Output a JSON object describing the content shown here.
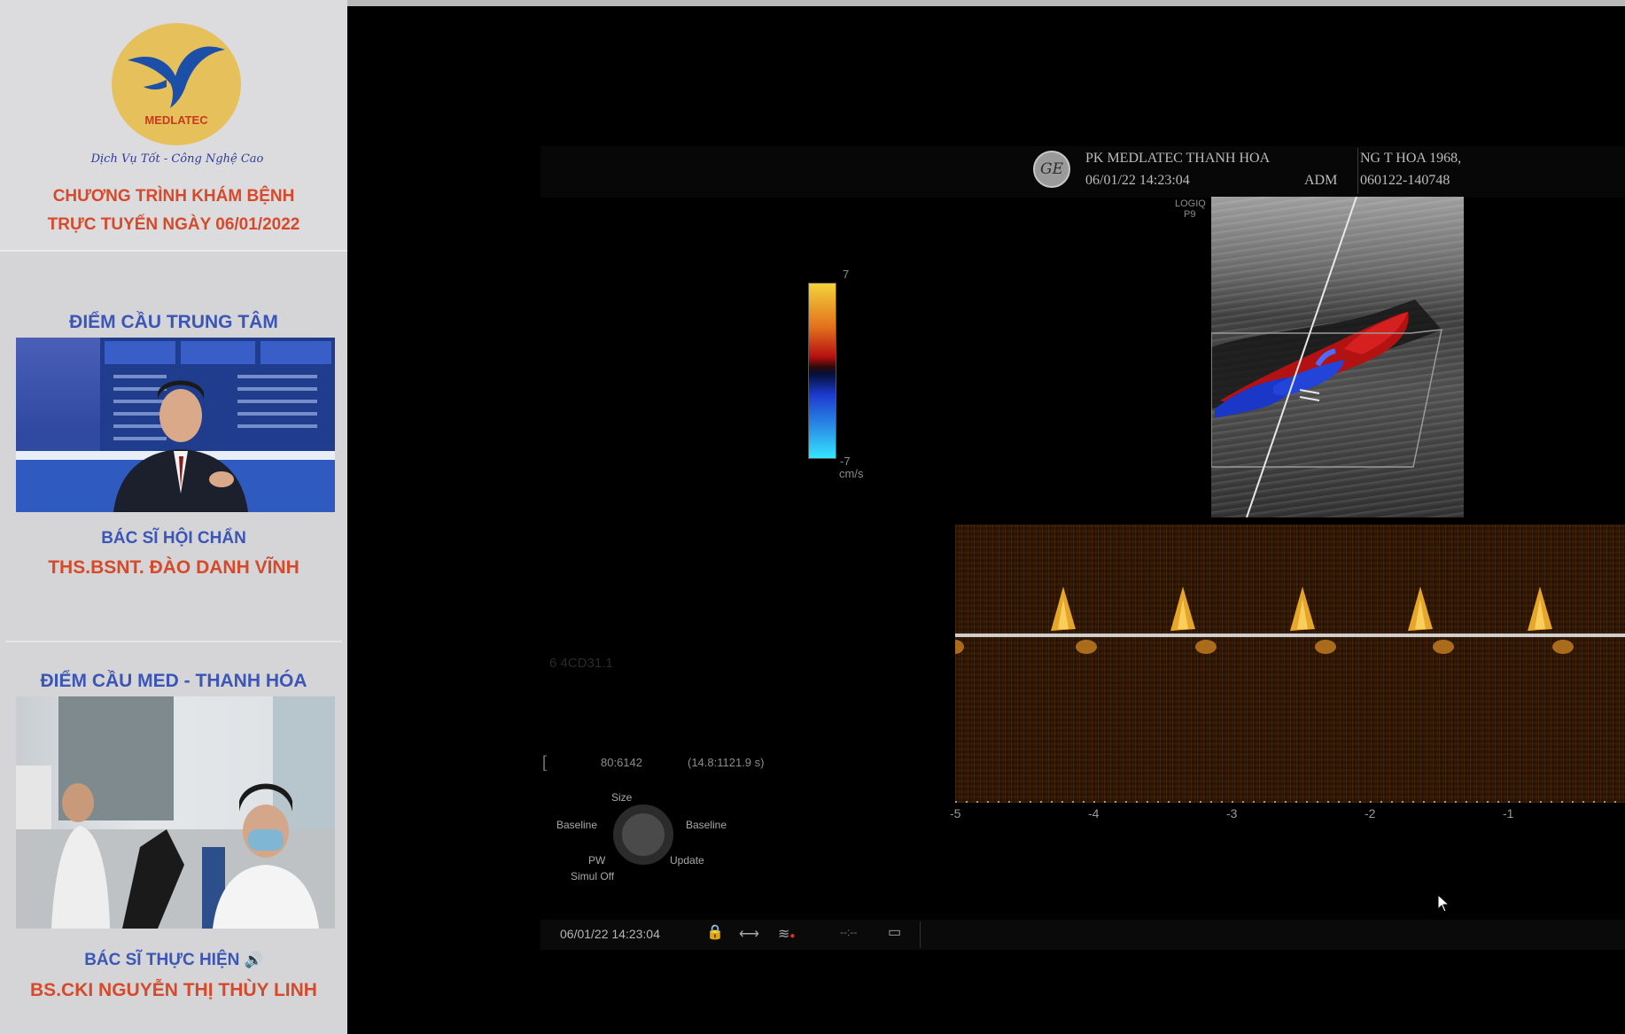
{
  "sidebar": {
    "logo_text": "MEDLATEC",
    "slogan": "Dịch Vụ Tốt - Công Nghệ Cao",
    "program_line1": "CHƯƠNG TRÌNH KHÁM BỆNH",
    "program_line2": "TRỰC TUYẾN NGÀY 06/01/2022",
    "section1": {
      "title": "ĐIỂM CẦU TRUNG TÂM",
      "role": "BÁC SĨ HỘI CHẨN",
      "doctor": "THS.BSNT. ĐÀO DANH VĨNH"
    },
    "section2": {
      "title": "ĐIỂM CẦU MED - THANH HÓA",
      "role": "BÁC SĨ THỰC HIỆN",
      "role_icon": "speaker-icon",
      "doctor": "BS.CKI NGUYỄN THỊ THÙY LINH"
    }
  },
  "ultrasound": {
    "logo_icon": "ge-logo",
    "clinic": "PK  MEDLATEC THANH HOA",
    "datetime": "06/01/22 14:23:04",
    "operator": "ADM",
    "patient_name": "NG T HOA 1968,",
    "patient_id": "060122-140748",
    "probe_label": "LOGIQ",
    "probe_preset": "P9",
    "color_scale_max": "7",
    "color_scale_min": "-7",
    "color_scale_unit": "cm/s",
    "left_readout1": "80:6142",
    "left_readout2": "(14.8:1121.9 s)",
    "faded_text": "6 4CD31.1",
    "time_axis": [
      "-5",
      "-4",
      "-3",
      "-2",
      "-1"
    ],
    "controls": {
      "size": "Size",
      "baseline_left": "Baseline",
      "baseline_right": "Baseline",
      "pw": "PW",
      "simul_off": "Simul Off",
      "update": "Update"
    },
    "status_datetime": "06/01/22 14:23:04",
    "status_icons": [
      "lock-icon",
      "arrows-icon",
      "wifi-icon",
      "dashes-icon",
      "monitor-icon"
    ]
  }
}
